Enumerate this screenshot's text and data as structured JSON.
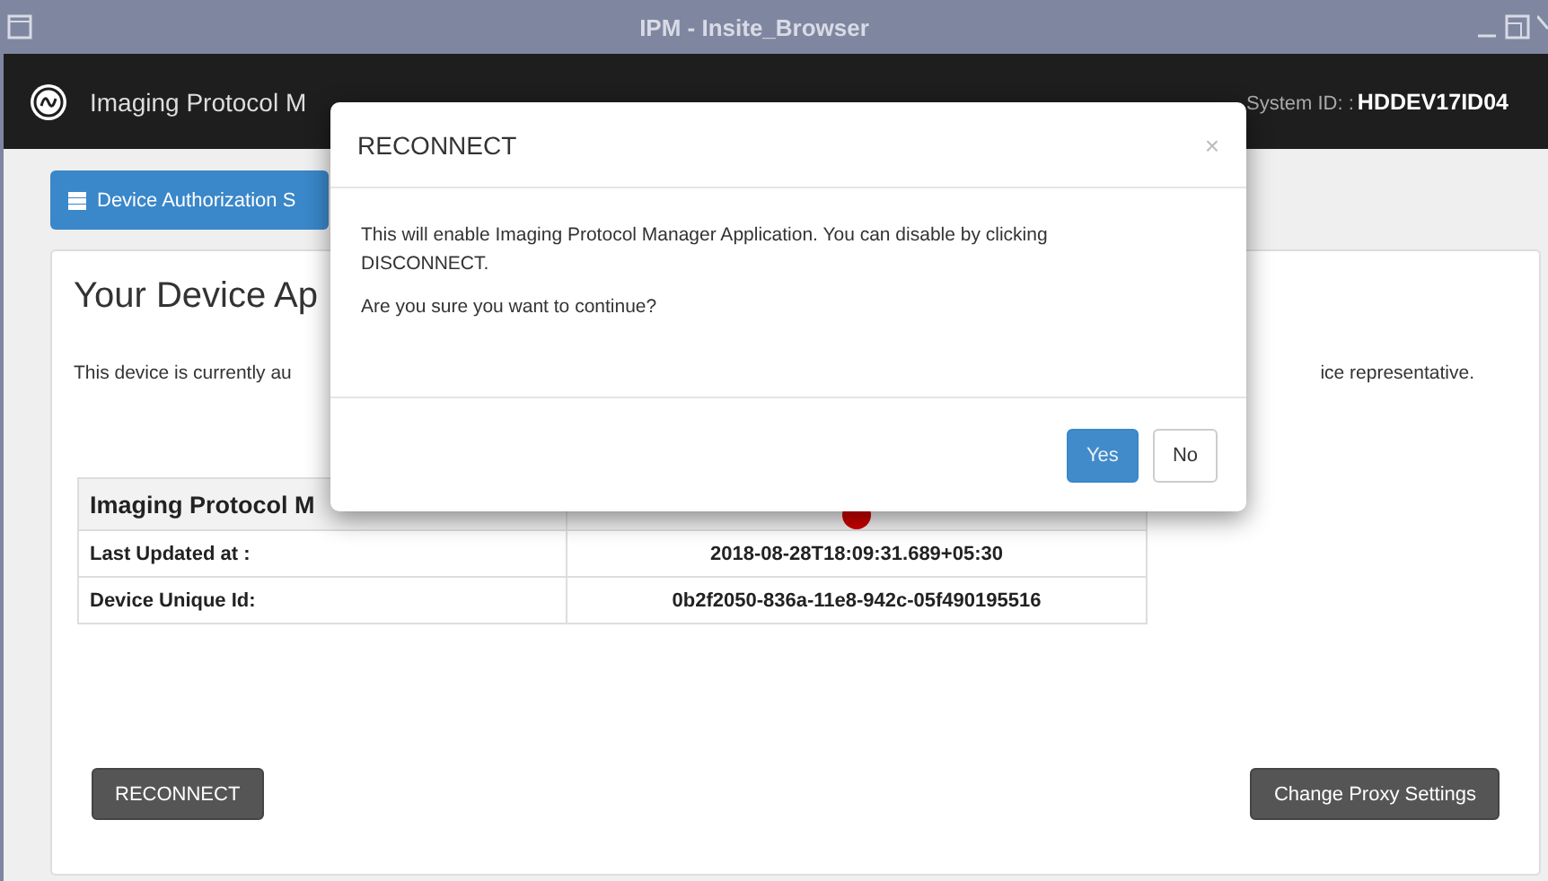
{
  "window": {
    "title": "IPM - Insite_Browser"
  },
  "header": {
    "app_name": "Imaging Protocol M",
    "system_id_label": "System ID: :",
    "system_id": "HDDEV17ID04"
  },
  "tabs": [
    {
      "label": "Device Authorization S",
      "selected": true
    }
  ],
  "panel": {
    "heading": "Your Device Ap",
    "description_left": "This device is currently au",
    "description_right": "ice representative.",
    "table": {
      "header": {
        "label": "Imaging Protocol M"
      },
      "rows": [
        {
          "label": "Last Updated at :",
          "value": "2018-08-28T18:09:31.689+05:30"
        },
        {
          "label": "Device Unique Id:",
          "value": "0b2f2050-836a-11e8-942c-05f490195516"
        }
      ]
    },
    "buttons": [
      {
        "label": "RECONNECT"
      },
      {
        "label": "Change Proxy Settings"
      }
    ]
  },
  "dialog": {
    "title": "RECONNECT",
    "close": "×",
    "message": "This will enable Imaging Protocol Manager Application. You can disable by clicking DISCONNECT.",
    "question": "Are you sure you want to continue?",
    "buttons": [
      {
        "label": "Yes",
        "kind": "primary"
      },
      {
        "label": "No",
        "kind": "default"
      }
    ]
  }
}
